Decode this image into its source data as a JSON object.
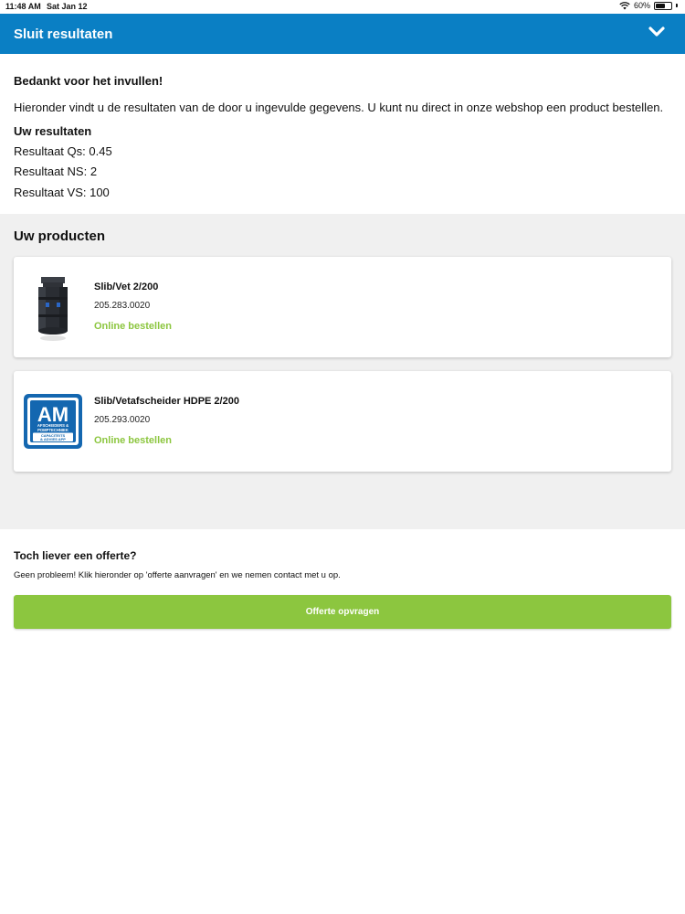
{
  "status_bar": {
    "time": "11:48 AM",
    "date": "Sat Jan 12",
    "battery": "60%",
    "battery_level": 0.6
  },
  "header": {
    "title": "Sluit resultaten",
    "icon": "chevron-down-icon",
    "color": "#0a7fc4"
  },
  "results": {
    "thanks": "Bedankt voor het invullen!",
    "intro": "Hieronder vindt u de resultaten van de door u ingevulde gegevens. U kunt nu direct in onze webshop een product bestellen.",
    "heading": "Uw resultaten",
    "lines": [
      "Resultaat Qs: 0.45",
      "Resultaat NS: 2",
      "Resultaat VS: 100"
    ]
  },
  "products": {
    "title": "Uw producten",
    "items": [
      {
        "name": "Slib/Vet 2/200",
        "code": "205.283.0020",
        "link": "Online bestellen",
        "image": "separator-tank-image"
      },
      {
        "name": "Slib/Vetafscheider HDPE 2/200",
        "code": "205.293.0020",
        "link": "Online bestellen",
        "image": "am-logo",
        "logo_text": [
          "AM",
          "AFSCHEIDERS &",
          "POMPTECHNIEK",
          "CAPACITEITS",
          "& ADVIES APP"
        ]
      }
    ]
  },
  "quote": {
    "title": "Toch liever een offerte?",
    "text": "Geen probleem! Klik hieronder op 'offerte aanvragen' en we nemen contact met u op.",
    "button": "Offerte opvragen"
  },
  "colors": {
    "accent_green": "#8cc63f",
    "header_blue": "#0a7fc4",
    "panel_gray": "#f0f0f0"
  }
}
